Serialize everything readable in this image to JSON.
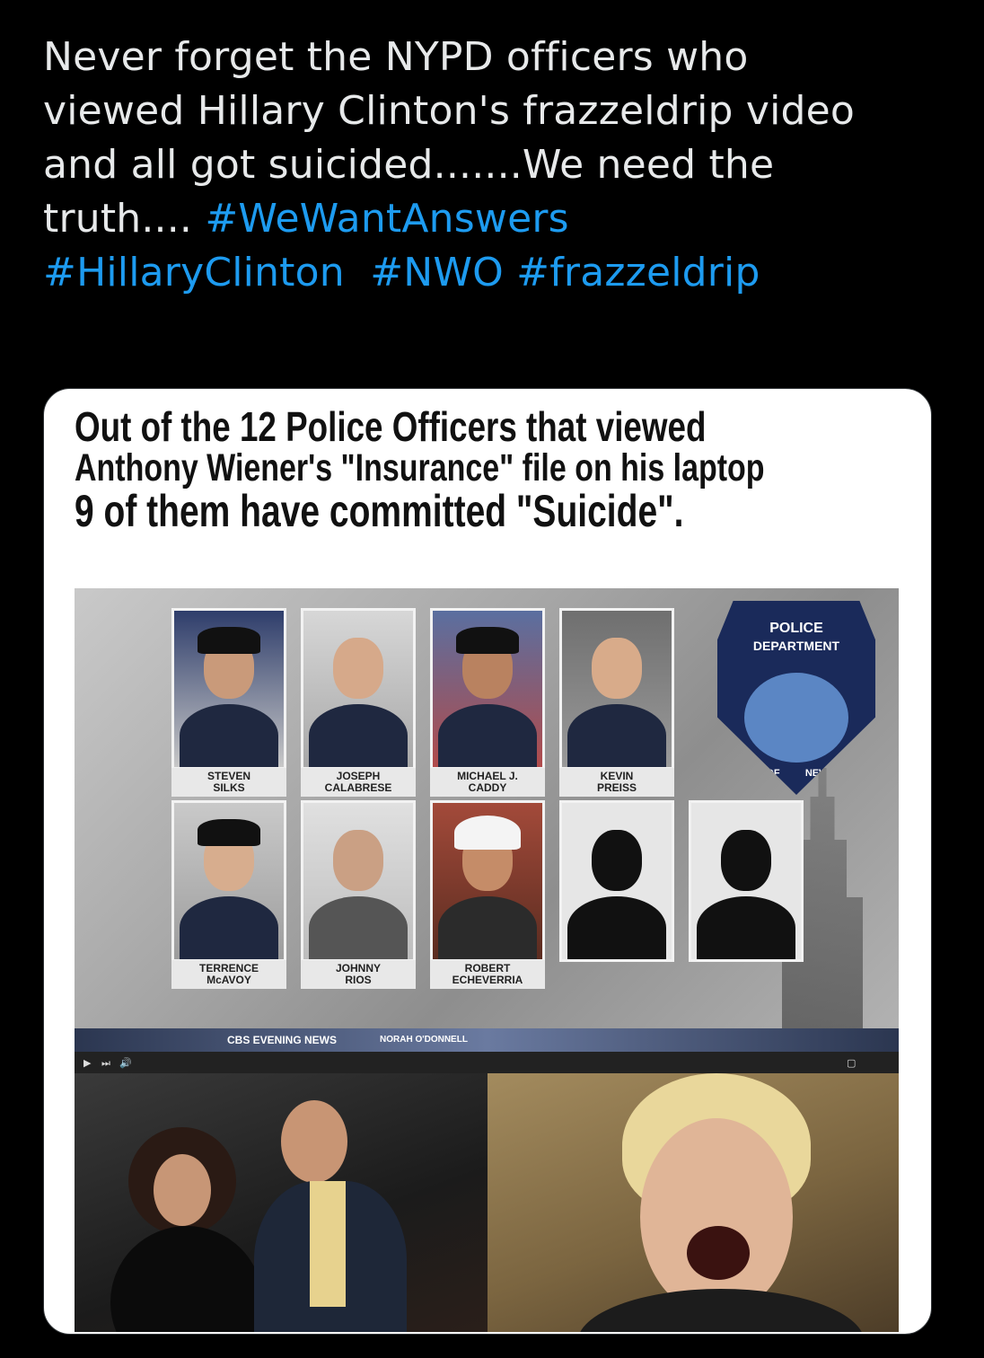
{
  "tweet": {
    "text_line1": "Never forget the NYPD officers who",
    "text_line2": "viewed Hillary Clinton's frazzeldrip video",
    "text_line3": "and all got suicided.......We need the",
    "text_line4_prefix": "truth.... ",
    "hashtags": [
      "#WeWantAnswers",
      "#HillaryClinton",
      "#NWO",
      "#frazzeldrip"
    ]
  },
  "meme": {
    "title_line1": "Out of the 12 Police Officers that viewed",
    "title_line2": "Anthony Wiener's \"Insurance\" file on his laptop",
    "title_line3": "9 of them have committed \"Suicide\".",
    "officers": [
      {
        "name_line1": "STEVEN",
        "name_line2": "SILKS"
      },
      {
        "name_line1": "JOSEPH",
        "name_line2": "CALABRESE"
      },
      {
        "name_line1": "MICHAEL J.",
        "name_line2": "CADDY"
      },
      {
        "name_line1": "KEVIN",
        "name_line2": "PREISS"
      },
      {
        "name_line1": "TERRENCE",
        "name_line2": "McAVOY"
      },
      {
        "name_line1": "JOHNNY",
        "name_line2": "RIOS"
      },
      {
        "name_line1": "ROBERT",
        "name_line2": "ECHEVERRIA"
      }
    ],
    "badge": {
      "top_line1": "POLICE",
      "top_line2": "DEPARTMENT",
      "left_text": "CITY OF",
      "right_text": "NEW YORK"
    },
    "ticker_text": "CBS EVENING NEWS",
    "ticker_anchor": "NORAH O'DONNELL"
  }
}
